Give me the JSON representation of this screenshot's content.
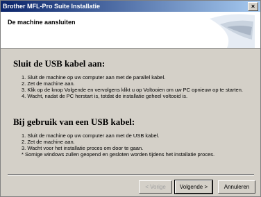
{
  "window": {
    "title": "Brother MFL-Pro Suite Installatie",
    "close_glyph": "×"
  },
  "header": {
    "title": "De machine aansluiten"
  },
  "section1": {
    "heading": "Sluit de USB kabel aan:",
    "lines": [
      "1. Sluit de machine op uw computer aan met de parallel kabel.",
      "2. Zet de machine aan.",
      "3. Klik op de knop Volgende en vervolgens klikt u op Voltooien om uw PC opnieuw op te starten.",
      "4. Wacht, nadat de PC herstart is, totdat de installatie geheel voltooid is."
    ]
  },
  "section2": {
    "heading": "Bij gebruik van een USB kabel:",
    "lines": [
      "1. Sluit de machine op uw computer aan met de USB kabel.",
      "2. Zet de machine aan.",
      "3. Wacht voor het installatie proces om door te gaan.",
      "* Somige windows zullen geopend en gesloten worden tijdens het installatie proces."
    ]
  },
  "buttons": {
    "back": "< Vorige",
    "next": "Volgende >",
    "cancel": "Annuleren"
  }
}
